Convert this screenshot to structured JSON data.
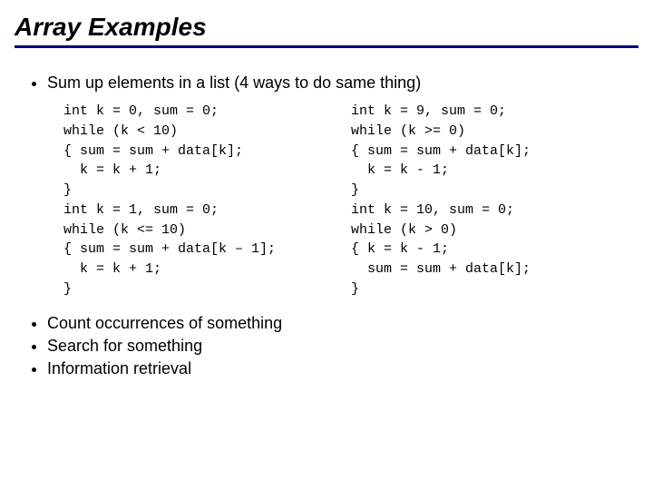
{
  "title": "Array Examples",
  "bullet_main": "Sum up elements in a list (4 ways to do same thing)",
  "code_left": "int k = 0, sum = 0;\nwhile (k < 10)\n{ sum = sum + data[k];\n  k = k + 1;\n}\nint k = 1, sum = 0;\nwhile (k <= 10)\n{ sum = sum + data[k – 1];\n  k = k + 1;\n}",
  "code_right": "int k = 9, sum = 0;\nwhile (k >= 0)\n{ sum = sum + data[k];\n  k = k - 1;\n}\nint k = 10, sum = 0;\nwhile (k > 0)\n{ k = k - 1;\n  sum = sum + data[k];\n}",
  "bullet_2": "Count occurrences of something",
  "bullet_3": "Search for something",
  "bullet_4": "Information retrieval"
}
